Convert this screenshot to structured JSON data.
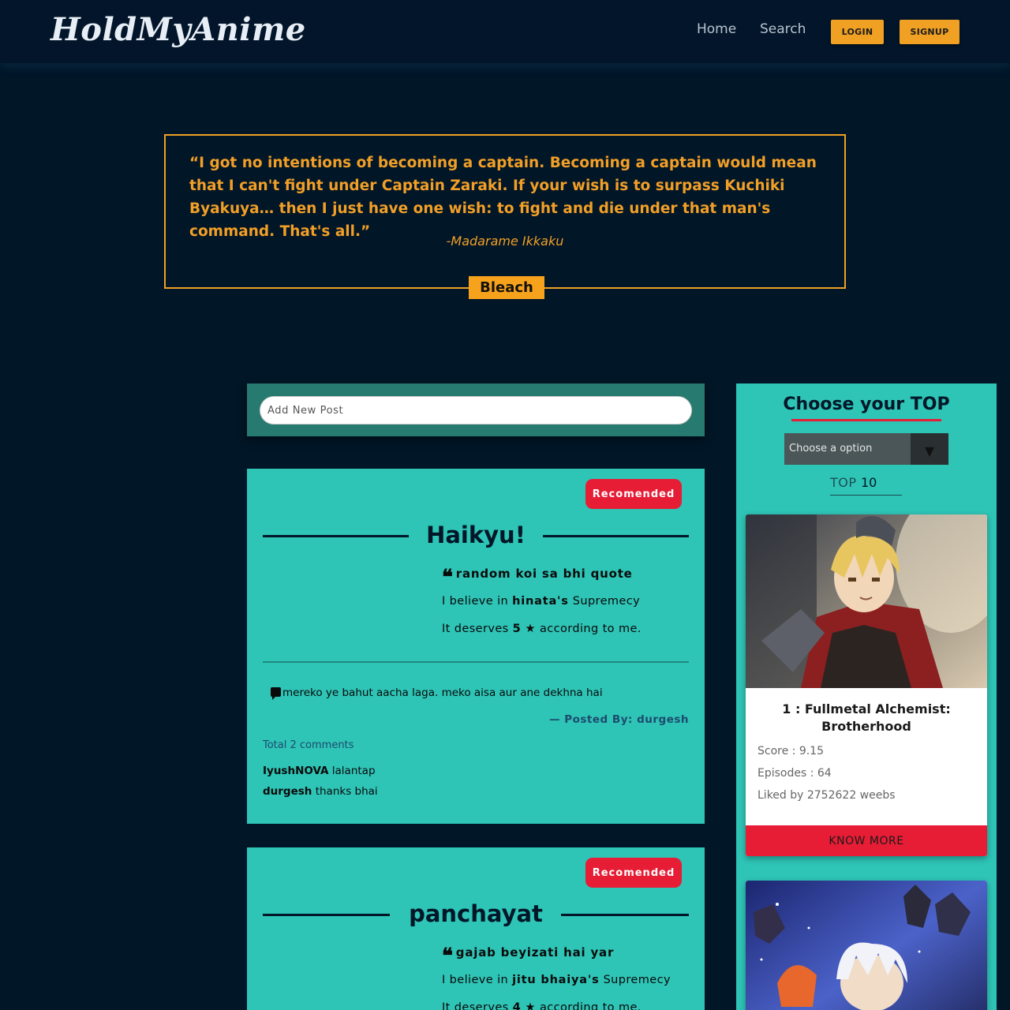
{
  "navbar": {
    "logo": "HoldMyAnime",
    "links": {
      "home": "Home",
      "search": "Search"
    },
    "buttons": {
      "login": "LOGIN",
      "signup": "SIGNUP"
    }
  },
  "quote": {
    "text": "“I got no intentions of becoming a captain. Becoming a captain would mean that I can't fight under Captain Zaraki. If your wish is to surpass Kuchiki Byakuya… then I just have one wish: to fight and die under that man's command. That's all.”",
    "author": "-Madarame Ikkaku",
    "anime": "Bleach",
    "accent_color": "#f29f27"
  },
  "add_post": {
    "placeholder": "Add New Post"
  },
  "posts": [
    {
      "badge": "Recomended",
      "title": "Haikyu!",
      "quote": "random koi sa bhi quote",
      "believe_prefix": "I believe in",
      "believe_name": "hinata's",
      "believe_suffix": "Supremecy",
      "deserves_prefix": "It deserves",
      "rating": "5",
      "deserves_suffix": "according to me.",
      "review": "mereko ye bahut aacha laga. meko aisa aur ane dekhna hai",
      "posted_by": "— Posted By: durgesh",
      "total_comments": "Total 2 comments",
      "comments": [
        {
          "user": "IyushNOVA",
          "text": "lalantap"
        },
        {
          "user": "durgesh",
          "text": "thanks bhai"
        }
      ]
    },
    {
      "badge": "Recomended",
      "title": "panchayat",
      "quote": "gajab beyizati hai yar",
      "believe_prefix": "I believe in",
      "believe_name": "jitu bhaiya's",
      "believe_suffix": "Supremecy",
      "deserves_prefix": "It deserves",
      "rating": "4",
      "deserves_suffix": "according to me."
    }
  ],
  "sidebar": {
    "title": "Choose your TOP",
    "select_placeholder": "Choose a option",
    "top_label": "TOP",
    "top_value": "10",
    "cards": [
      {
        "name": "1 : Fullmetal Alchemist: Brotherhood",
        "score": "Score : 9.15",
        "episodes": "Episodes : 64",
        "liked": "Liked by 2752622 weebs",
        "button": "KNOW MORE"
      }
    ]
  },
  "colors": {
    "background": "#011627",
    "accent_orange": "#f0a023",
    "teal": "#2ec4b6",
    "red": "#e71d36"
  }
}
